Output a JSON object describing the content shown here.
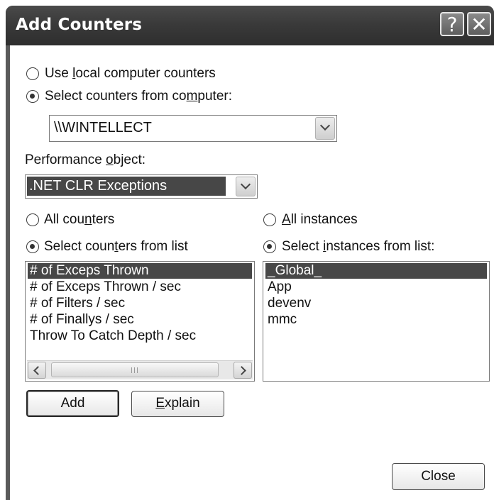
{
  "window": {
    "title": "Add Counters",
    "help_glyph": "?",
    "close_glyph": "✕"
  },
  "source": {
    "local_label_pre": "Use ",
    "local_label_ul": "l",
    "local_label_post": "ocal computer counters",
    "local_checked": false,
    "remote_label_pre": "Select counters from co",
    "remote_label_ul": "m",
    "remote_label_post": "puter:",
    "remote_checked": true,
    "computer_value": "\\\\WINTELLECT"
  },
  "performance_object": {
    "label_pre": "Performance ",
    "label_ul": "o",
    "label_post": "bject:",
    "value": ".NET CLR Exceptions"
  },
  "counters": {
    "all_label_pre": "All cou",
    "all_label_ul": "n",
    "all_label_post": "ters",
    "all_checked": false,
    "list_label_pre": "Select coun",
    "list_label_ul": "t",
    "list_label_post": "ers from list",
    "list_checked": true,
    "items": [
      "# of Exceps Thrown",
      "# of Exceps Thrown / sec",
      "# of Filters / sec",
      "# of Finallys / sec",
      "Throw To Catch Depth / sec"
    ],
    "selected_index": 0
  },
  "instances": {
    "all_label_pre": "",
    "all_label_ul": "A",
    "all_label_post": "ll instances",
    "all_checked": false,
    "list_label_pre": "Select ",
    "list_label_ul": "i",
    "list_label_post": "nstances from list:",
    "list_checked": true,
    "items": [
      "_Global_",
      "App",
      "devenv",
      "mmc"
    ],
    "selected_index": 0
  },
  "buttons": {
    "add": "Add",
    "explain_ul": "E",
    "explain_post": "xplain",
    "close": "Close"
  },
  "colors": {
    "title_bar": "#3a3a3a",
    "selection": "#474747"
  }
}
